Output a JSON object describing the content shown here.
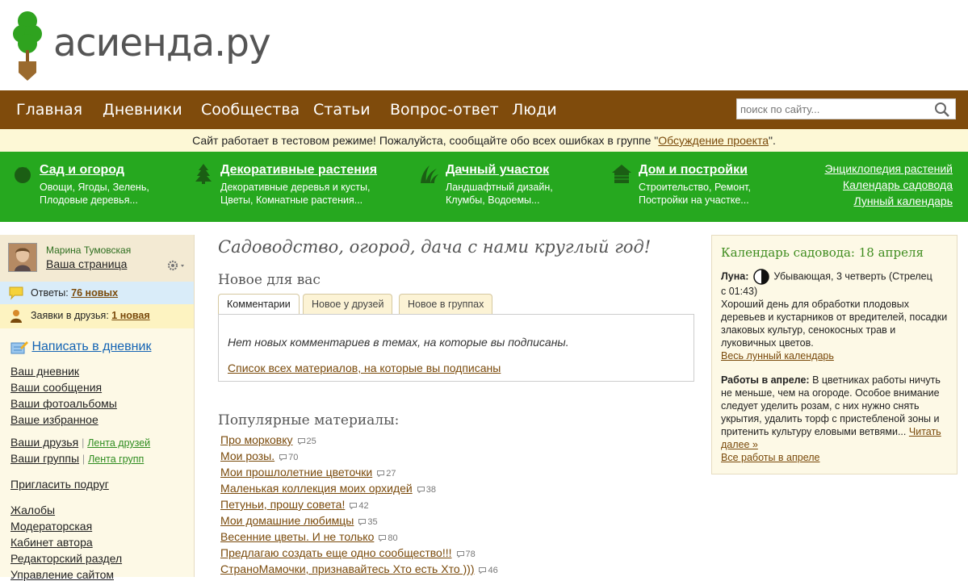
{
  "logo": {
    "text": "асиенда.ру"
  },
  "nav": {
    "items": [
      "Главная",
      "Дневники",
      "Сообщества",
      "Статьи",
      "Вопрос-ответ",
      "Люди"
    ],
    "search_placeholder": "поиск по сайту..."
  },
  "notice": {
    "text_before": "Сайт работает в тестовом режиме! Пожалуйста, сообщайте обо всех ошибках в группе \"",
    "link": "Обсуждение проекта",
    "text_after": "\"."
  },
  "categories": [
    {
      "title": "Сад и огород",
      "line1": "Овощи, Ягоды, Зелень,",
      "line2": "Плодовые деревья..."
    },
    {
      "title": "Декоративные растения",
      "line1": "Декоративные деревья и кусты,",
      "line2": "Цветы, Комнатные растения..."
    },
    {
      "title": "Дачный участок",
      "line1": "Ландшафтный дизайн,",
      "line2": "Клумбы, Водоемы..."
    },
    {
      "title": "Дом и постройки",
      "line1": "Строительство, Ремонт,",
      "line2": "Постройки на участке..."
    }
  ],
  "right_links": [
    "Энциклопедия растений",
    "Календарь садовода",
    "Лунный календарь"
  ],
  "sidebar": {
    "user_name": "Марина Тумовская",
    "user_page": "Ваша страница",
    "answers_label": "Ответы:",
    "answers_link": "76 новых",
    "requests_label": "Заявки в друзья:",
    "requests_link": "1 новая",
    "write_link": "Написать в дневник",
    "links1": [
      "Ваш дневник",
      "Ваши сообщения",
      "Ваши фотоальбомы",
      "Ваше избранное"
    ],
    "friends": "Ваши друзья",
    "friends_feed": "Лента друзей",
    "groups": "Ваши группы",
    "groups_feed": "Лента групп",
    "invite": "Пригласить подруг",
    "links3": [
      "Жалобы",
      "Модераторская",
      "Кабинет автора",
      "Редакторский раздел",
      "Управление сайтом"
    ]
  },
  "main": {
    "headline": "Садоводство, огород, дача с нами круглый год!",
    "new_title": "Новое для вас",
    "tabs": [
      "Комментарии",
      "Новое у друзей",
      "Новое в группах"
    ],
    "tab_message": "Нет новых комментариев в темах, на которые вы подписаны.",
    "tab_link": "Список всех материалов, на которые вы подписаны",
    "popular_title": "Популярные материалы:",
    "popular": [
      {
        "title": "Про морковку",
        "count": "25"
      },
      {
        "title": "Мои розы.",
        "count": "70"
      },
      {
        "title": "Мои прошлолетние цветочки",
        "count": "27"
      },
      {
        "title": "Маленькая коллекция моих орхидей",
        "count": "38"
      },
      {
        "title": "Петуньи, прошу совета!",
        "count": "42"
      },
      {
        "title": "Мои домашние любимцы",
        "count": "35"
      },
      {
        "title": "Весенние цветы. И не только",
        "count": "80"
      },
      {
        "title": "Предлагаю создать еще одно сообщество!!!",
        "count": "78"
      },
      {
        "title": "СтраноМамочки, признавайтесь Хто есть Хто )))",
        "count": "46"
      }
    ]
  },
  "calendar": {
    "title": "Календарь садовода: 18 апреля",
    "moon_label": "Луна:",
    "moon_text1": "Убывающая, 3 четверть (Стрелец",
    "moon_text2": "с 01:43)",
    "day_text": "Хороший день для обработки плодовых деревьев и кустарников от вредителей, посадки злаковых культур, сенокосных трав и луковичных цветов.",
    "moon_link": "Весь лунный календарь",
    "works_label": "Работы в апреле:",
    "works_text": "В цветниках работы ничуть не меньше, чем на огороде. Особое внимание следует уделить розам, с них нужно снять укрытия, удалить торф с пристебленой зоны и притенить культуру еловыми ветвями...",
    "read_more": "Читать далее »",
    "works_link": "Все работы в апреле"
  }
}
